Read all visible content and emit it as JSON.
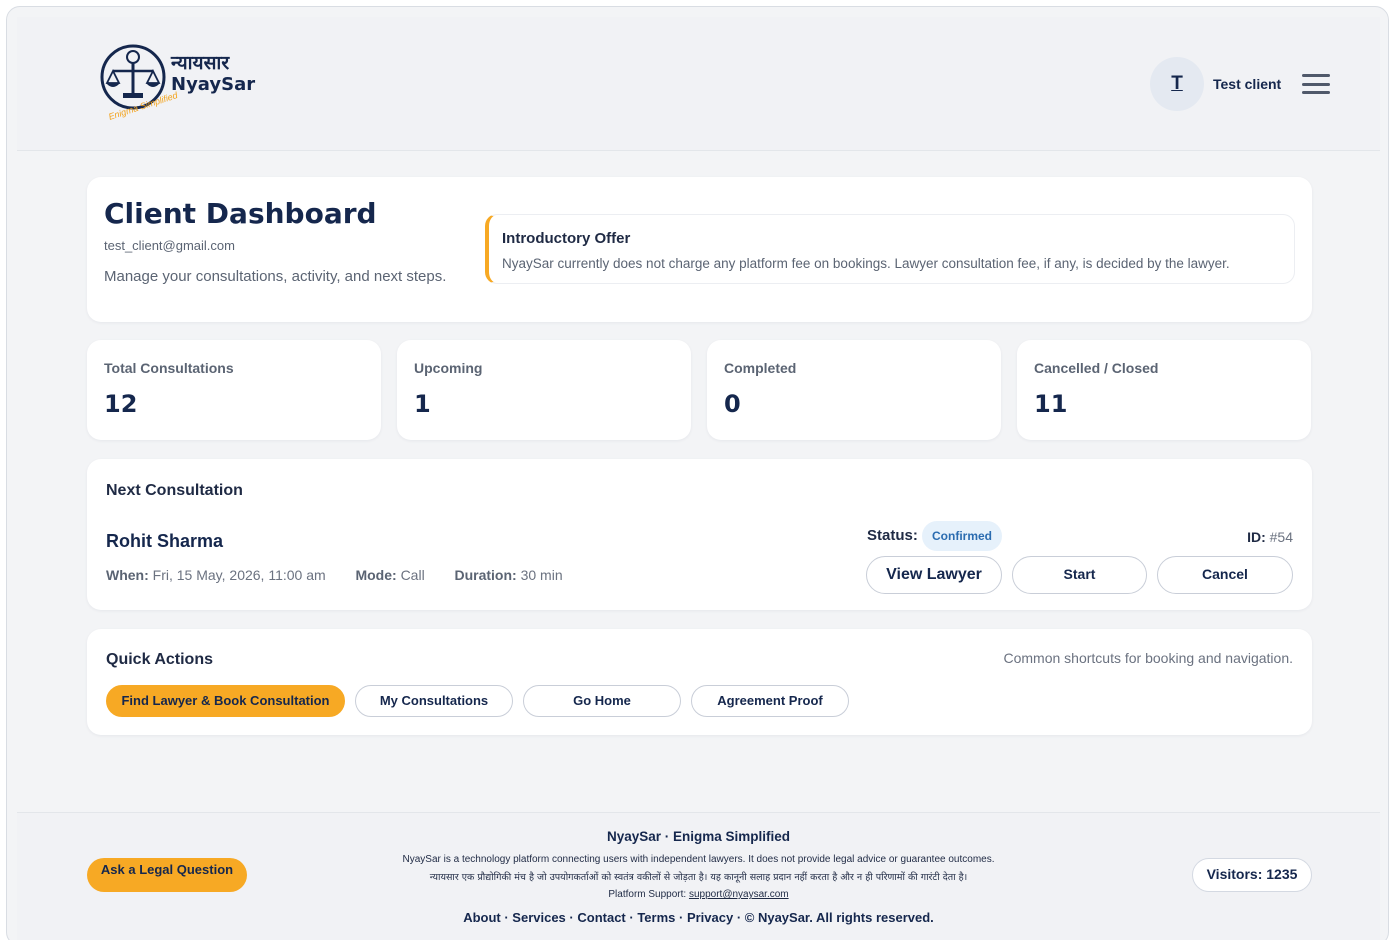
{
  "brand": {
    "name_hindi": "न्यायसार",
    "name": "NyaySar",
    "tagline": "Enigma Simplified"
  },
  "user": {
    "avatar_letter": "T",
    "name": "Test client"
  },
  "dashboard": {
    "title": "Client Dashboard",
    "email": "test_client@gmail.com",
    "subtitle": "Manage your consultations, activity, and next steps.",
    "offer": {
      "title": "Introductory Offer",
      "text": "NyaySar currently does not charge any platform fee on bookings. Lawyer consultation fee, if any, is decided by the lawyer."
    }
  },
  "stats": [
    {
      "label": "Total Consultations",
      "value": "12"
    },
    {
      "label": "Upcoming",
      "value": "1"
    },
    {
      "label": "Completed",
      "value": "0"
    },
    {
      "label": "Cancelled / Closed",
      "value": "11"
    }
  ],
  "next_consultation": {
    "section_title": "Next Consultation",
    "lawyer": "Rohit Sharma",
    "when_label": "When:",
    "when": "Fri, 15 May, 2026, 11:00 am",
    "mode_label": "Mode:",
    "mode": "Call",
    "duration_label": "Duration:",
    "duration": "30 min",
    "status_label": "Status:",
    "status": "Confirmed",
    "id_label": "ID:",
    "id": "#54",
    "buttons": {
      "view": "View Lawyer",
      "start": "Start",
      "cancel": "Cancel"
    }
  },
  "quick_actions": {
    "title": "Quick Actions",
    "hint": "Common shortcuts for booking and navigation.",
    "buttons": [
      "Find Lawyer & Book Consultation",
      "My Consultations",
      "Go Home",
      "Agreement Proof"
    ]
  },
  "footer": {
    "ask_button": "Ask a Legal Question",
    "title": "NyaySar · Enigma Simplified",
    "disclaimer_en": "NyaySar is a technology platform connecting users with independent lawyers. It does not provide legal advice or guarantee outcomes.",
    "disclaimer_hi": "न्यायसार एक प्रौद्योगिकी मंच है जो उपयोगकर्ताओं को स्वतंत्र वकीलों से जोड़ता है। यह कानूनी सलाह प्रदान नहीं करता है और न ही परिणामों की गारंटी देता है।",
    "support_label": "Platform Support:",
    "support_email": "support@nyaysar.com",
    "links": [
      "About",
      "Services",
      "Contact",
      "Terms",
      "Privacy"
    ],
    "copyright": "© NyaySar. All rights reserved.",
    "visitors": "Visitors: 1235"
  },
  "colors": {
    "accent": "#f7a924",
    "navy": "#15274d",
    "status_bg": "#e6f1fb",
    "status_text": "#2b6cb0"
  }
}
